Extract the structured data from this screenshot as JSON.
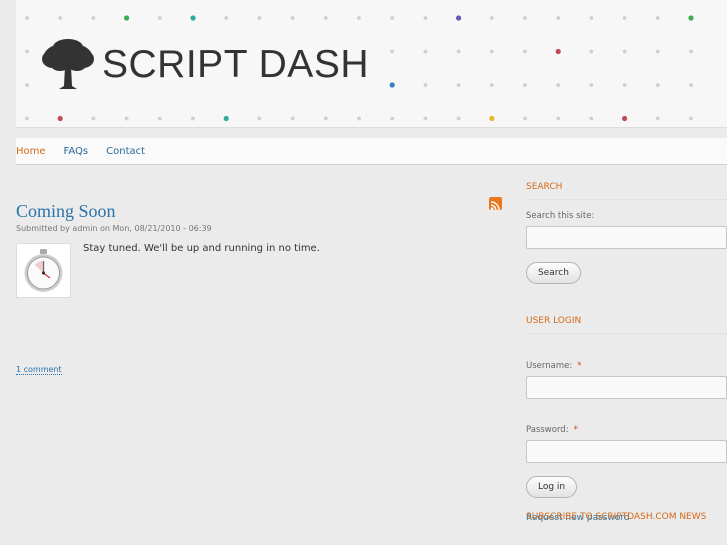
{
  "header": {
    "site_name": "SCRIPT DASH",
    "logo_icon": "tree-icon"
  },
  "nav": {
    "items": [
      {
        "label": "Home"
      },
      {
        "label": "FAQs"
      },
      {
        "label": "Contact"
      }
    ]
  },
  "post": {
    "title": "Coming Soon",
    "submitted": "Submitted by admin on Mon, 08/21/2010 - 06:39",
    "body": "Stay tuned. We'll be up and running in no time.",
    "comments_link": "1 comment",
    "thumbnail_icon": "stopwatch-icon",
    "feed_icon": "rss-icon"
  },
  "sidebar": {
    "search": {
      "title": "SEARCH",
      "label": "Search this site:",
      "button": "Search"
    },
    "login": {
      "title": "USER LOGIN",
      "username_label": "Username:",
      "password_label": "Password:",
      "required_mark": "*",
      "button": "Log in",
      "new_password_link": "Request new password"
    },
    "subscribe": {
      "title": "SUBSCRIBE TO SCRIPTDASH.COM NEWS"
    }
  },
  "colors": {
    "accent": "#d46a1a",
    "link": "#2874a8",
    "background": "#ebebeb",
    "header_dots": [
      "#3cae4f",
      "#2bab9a",
      "#6a56b4",
      "#c04a58",
      "#3a7fc4",
      "#e8b430",
      "#cfcfcf"
    ]
  }
}
